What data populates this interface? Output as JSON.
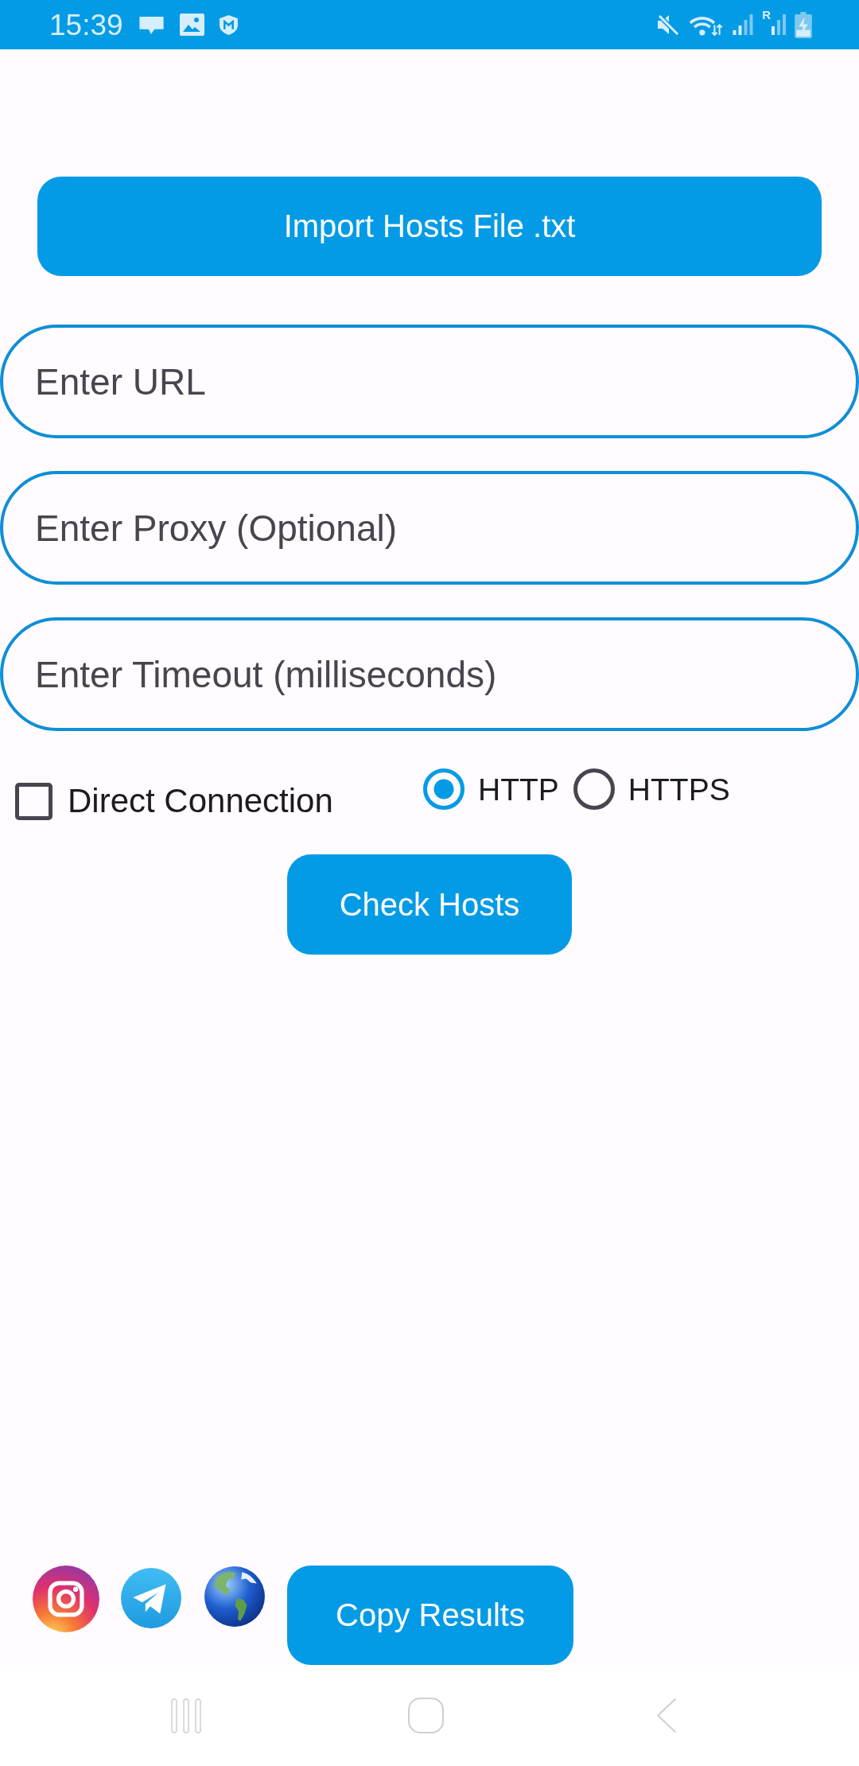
{
  "status_bar": {
    "time": "15:39",
    "roaming_indicator": "R"
  },
  "import_button": {
    "label": "Import Hosts File .txt"
  },
  "fields": [
    {
      "placeholder": "Enter URL"
    },
    {
      "placeholder": "Enter Proxy (Optional)"
    },
    {
      "placeholder": "Enter Timeout (milliseconds)"
    }
  ],
  "direct_connection": {
    "label": "Direct Connection",
    "checked": false
  },
  "protocols": [
    {
      "label": "HTTP",
      "selected": true
    },
    {
      "label": "HTTPS",
      "selected": false
    }
  ],
  "check_button": {
    "label": "Check Hosts"
  },
  "copy_button": {
    "label": "Copy Results"
  }
}
